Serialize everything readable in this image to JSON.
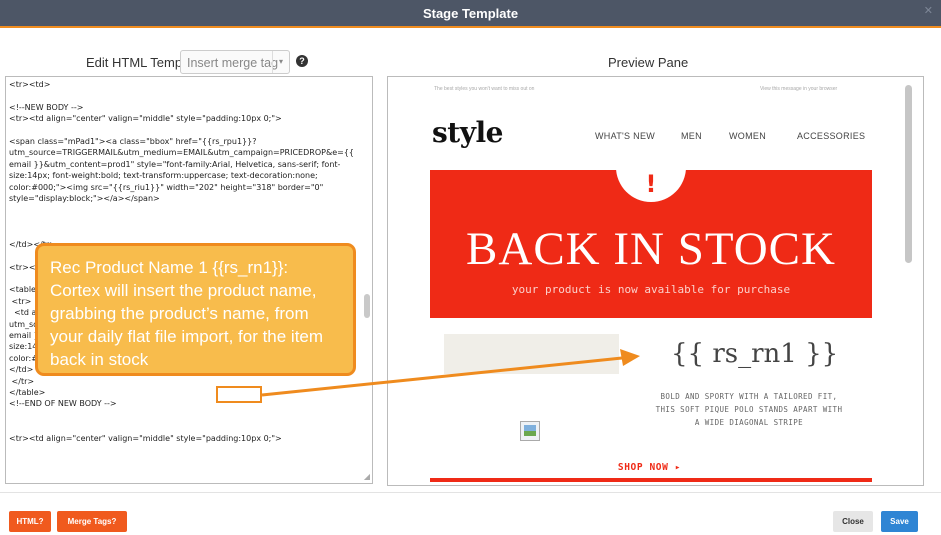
{
  "window": {
    "title": "Stage Template",
    "close_glyph": "✕"
  },
  "editor": {
    "label": "Edit HTML Template",
    "merge_select_placeholder": "Insert merge tag",
    "help_glyph": "?",
    "code_lines": [
      "<tr><td>",
      "",
      "<!--NEW BODY -->",
      "<tr><td align=\"center\" valign=\"middle\" style=\"padding:10px 0;\">",
      "",
      "<span class=\"mPad1\"><a class=\"bbox\" href=\"{{rs_rpu1}}?",
      "utm_source=TRIGGERMAIL&utm_medium=EMAIL&utm_campaign=PRICEDROP&e={{",
      "email }}&utm_content=prod1\" style=\"font-family:Arial, Helvetica, sans-serif; font-",
      "size:14px; font-weight:bold; text-transform:uppercase; text-decoration:none;",
      "color:#000;\"><img src=\"{{rs_riu1}}\" width=\"202\" height=\"318\" border=\"0\"",
      "style=\"display:block;\"></a></span>",
      "",
      "",
      "",
      "</td></tr>",
      "",
      "<tr><td",
      "",
      "<table",
      " <tr>",
      "  <td a",
      "utm_so",
      "email }",
      "size:14px; font-weight:bold; text-transform:uppercase; text-decoration:none;",
      "color:#000;\"><br class=\"mHide\"><span class=\"bbox\">{{rs_rn1}}</span></a></td>",
      " </tr>",
      "</table>",
      "<!--END OF NEW BODY -->",
      "",
      "",
      "<tr><td align=\"center\" valign=\"middle\" style=\"padding:10px 0;\">"
    ]
  },
  "preview": {
    "label": "Preview Pane",
    "email": {
      "preheader_left": "The best styles you won't want to miss out on",
      "preheader_right": "View this message in your browser",
      "logo": "style",
      "nav": [
        "WHAT'S NEW",
        "MEN",
        "WOMEN",
        "ACCESSORIES"
      ],
      "hero_mark": "!",
      "hero_title": "BACK IN STOCK",
      "hero_subtitle": "your product is now available for purchase",
      "product_name_tag": "{{ rs_rn1 }}",
      "description": "BOLD AND SPORTY WITH A TAILORED FIT, THIS SOFT PIQUE POLO STANDS APART WITH A WIDE DIAGONAL STRIPE",
      "cta": "SHOP NOW ▸"
    }
  },
  "callout": {
    "text": "Rec Product Name 1 {{rs_rn1}}: Cortex will insert the product name, grabbing the product’s name, from your daily flat file import, for the item back in stock"
  },
  "footer": {
    "html_help": "HTML?",
    "merge_tags_help": "Merge Tags?",
    "close": "Close",
    "save": "Save"
  },
  "colors": {
    "titlebar": "#4d5666",
    "accent_orange": "#f08c1e",
    "hero_red": "#ef2a16",
    "callout_fill": "#f8bc4c",
    "save_blue": "#2f85d4"
  },
  "icons": [
    "help-circle-icon",
    "dropdown-caret-icon",
    "broken-image-icon",
    "resize-grip-icon"
  ]
}
